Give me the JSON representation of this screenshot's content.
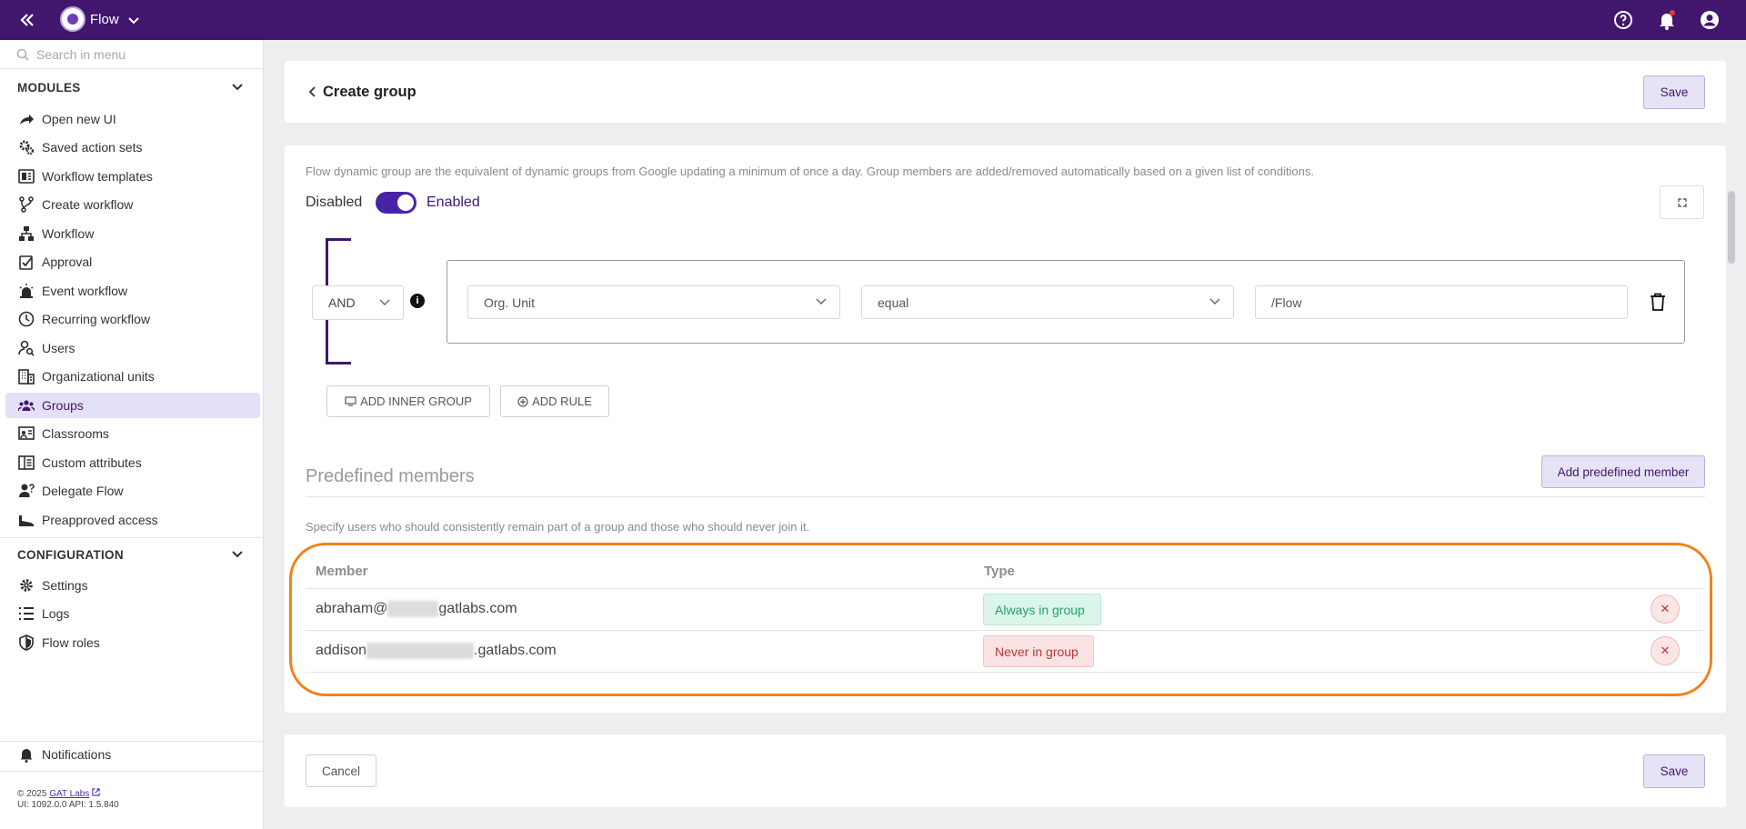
{
  "topbar": {
    "app_name": "Flow"
  },
  "sidebar": {
    "search_placeholder": "Search in menu",
    "modules_title": "MODULES",
    "modules": [
      {
        "label": "Open new UI",
        "icon": "share-arrow-icon"
      },
      {
        "label": "Saved action sets",
        "icon": "gear-cog-icon"
      },
      {
        "label": "Workflow templates",
        "icon": "template-icon"
      },
      {
        "label": "Create workflow",
        "icon": "branch-icon"
      },
      {
        "label": "Workflow",
        "icon": "hierarchy-icon"
      },
      {
        "label": "Approval",
        "icon": "approval-check-icon"
      },
      {
        "label": "Event workflow",
        "icon": "alarm-light-icon"
      },
      {
        "label": "Recurring workflow",
        "icon": "clock-icon"
      },
      {
        "label": "Users",
        "icon": "user-search-icon"
      },
      {
        "label": "Organizational units",
        "icon": "building-icon"
      },
      {
        "label": "Groups",
        "icon": "groups-icon",
        "active": true
      },
      {
        "label": "Classrooms",
        "icon": "classroom-icon"
      },
      {
        "label": "Custom attributes",
        "icon": "attributes-icon"
      },
      {
        "label": "Delegate Flow",
        "icon": "delegate-user-icon"
      },
      {
        "label": "Preapproved access",
        "icon": "preapproved-icon"
      }
    ],
    "configuration_title": "CONFIGURATION",
    "configuration": [
      {
        "label": "Settings",
        "icon": "gear-icon"
      },
      {
        "label": "Logs",
        "icon": "list-icon"
      },
      {
        "label": "Flow roles",
        "icon": "shield-icon"
      }
    ],
    "notifications_label": "Notifications",
    "footer_copyright": "© 2025",
    "footer_link": "GAT Labs",
    "footer_version": "UI: 1092.0.0 API: 1.5.840"
  },
  "header": {
    "title": "Create group",
    "save_label": "Save"
  },
  "rules": {
    "description": "Flow dynamic group are the equivalent of dynamic groups from Google updating a minimum of once a day. Group members are added/removed automatically based on a given list of conditions.",
    "toggle_off_label": "Disabled",
    "toggle_on_label": "Enabled",
    "toggle_enabled": true,
    "operator": "AND",
    "rule": {
      "field": "Org. Unit",
      "condition": "equal",
      "value": "/Flow"
    },
    "add_inner_group_label": "ADD INNER GROUP",
    "add_rule_label": "ADD RULE"
  },
  "predefined": {
    "title": "Predefined members",
    "add_button_label": "Add predefined member",
    "description": "Specify users who should consistently remain part of a group and those who should never join it.",
    "columns": [
      "Member",
      "Type"
    ],
    "rows": [
      {
        "member_prefix": "abraham@",
        "member_suffix": "gatlabs.com",
        "type": "Always in group"
      },
      {
        "member_prefix": "addison",
        "member_suffix": ".gatlabs.com",
        "type": "Never in group"
      }
    ]
  },
  "footer_actions": {
    "cancel_label": "Cancel",
    "save_label": "Save"
  },
  "colors": {
    "topbar": "#40176c",
    "accent": "#4a22a8",
    "highlight": "#f0821e"
  }
}
